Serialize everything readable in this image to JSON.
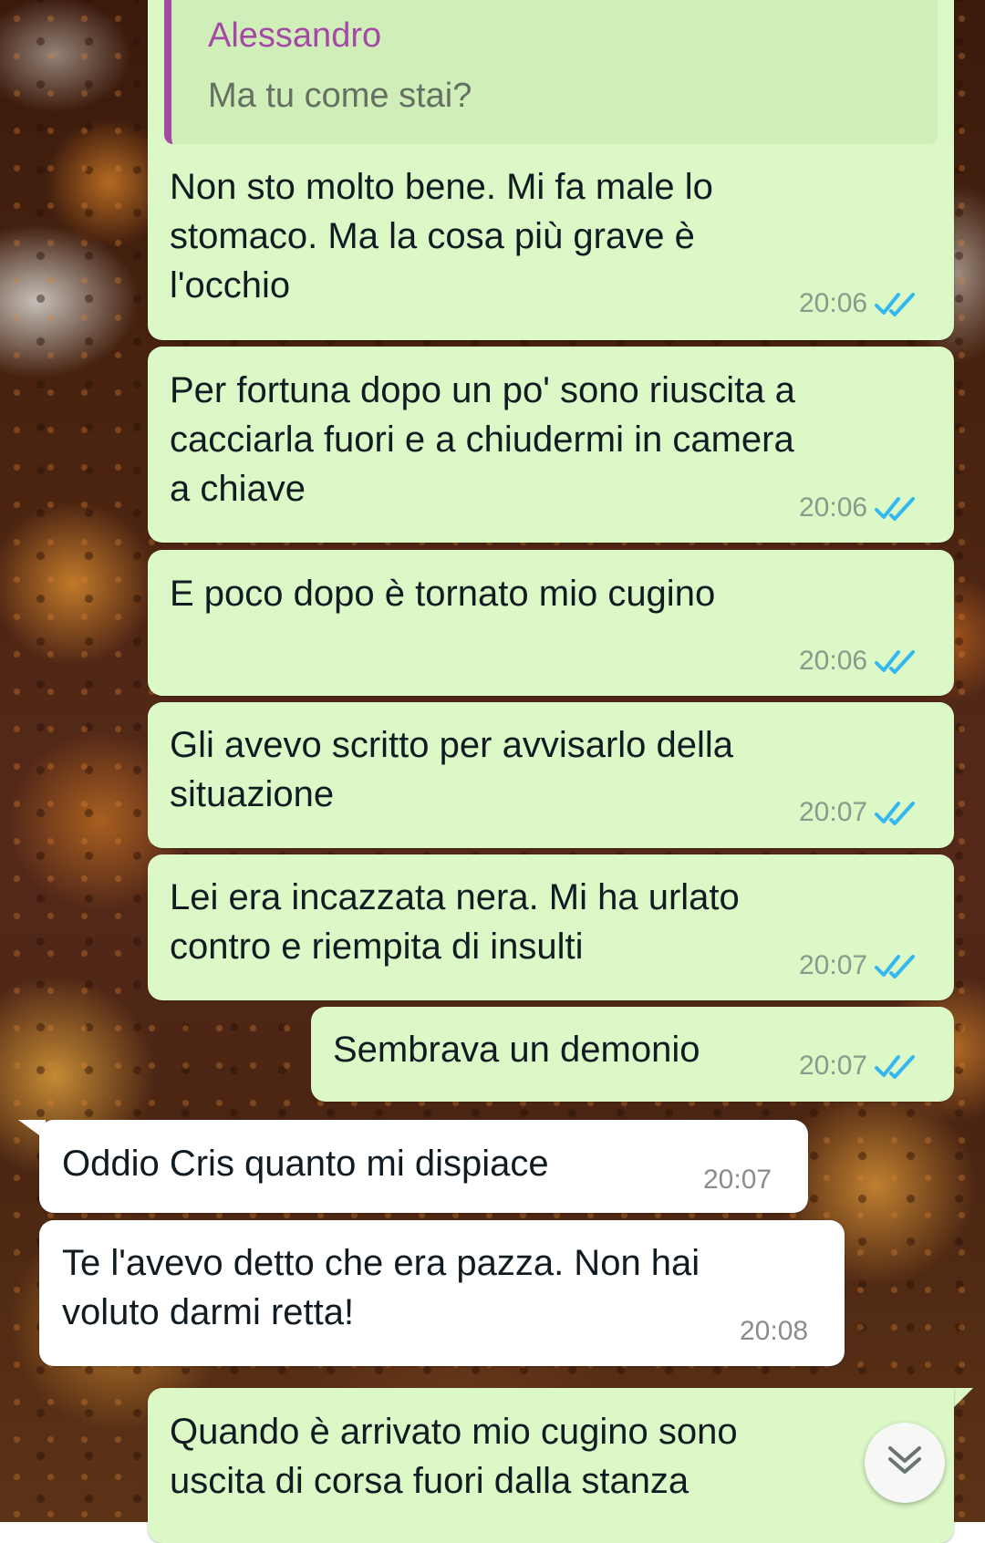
{
  "quoted_message": {
    "author": "Alessandro",
    "text": "Ma tu come stai?"
  },
  "messages": [
    {
      "direction": "out",
      "text": "Non sto molto bene. Mi fa male lo\nstomaco. Ma la cosa più grave è\nl'occhio",
      "time": "20:06",
      "status": "read"
    },
    {
      "direction": "out",
      "text": "Per fortuna dopo un po' sono riuscita a\ncacciarla fuori e a chiudermi in camera\na chiave",
      "time": "20:06",
      "status": "read"
    },
    {
      "direction": "out",
      "text": "E poco dopo è tornato mio cugino",
      "time": "20:06",
      "status": "read"
    },
    {
      "direction": "out",
      "text": "Gli avevo scritto per avvisarlo della\nsituazione",
      "time": "20:07",
      "status": "read"
    },
    {
      "direction": "out",
      "text": "Lei era incazzata nera. Mi ha urlato\ncontro e riempita di insulti",
      "time": "20:07",
      "status": "read"
    },
    {
      "direction": "out",
      "text": "Sembrava un demonio",
      "time": "20:07",
      "status": "read"
    },
    {
      "direction": "in",
      "text": "Oddio Cris quanto mi dispiace",
      "time": "20:07"
    },
    {
      "direction": "in",
      "text": "Te l'avevo detto che era pazza. Non hai\nvoluto darmi retta!",
      "time": "20:08"
    },
    {
      "direction": "out",
      "text": "Quando è arrivato mio cugino sono\nuscita di corsa fuori dalla stanza",
      "time": "",
      "status": "read"
    }
  ],
  "icons": {
    "read_receipt": "double-check-icon",
    "scroll_down": "double-chevron-down-icon"
  },
  "colors": {
    "outgoing_bubble": "#dcf8c6",
    "incoming_bubble": "#ffffff",
    "quote_accent": "#a44aa6",
    "read_tick": "#34b7f1"
  }
}
